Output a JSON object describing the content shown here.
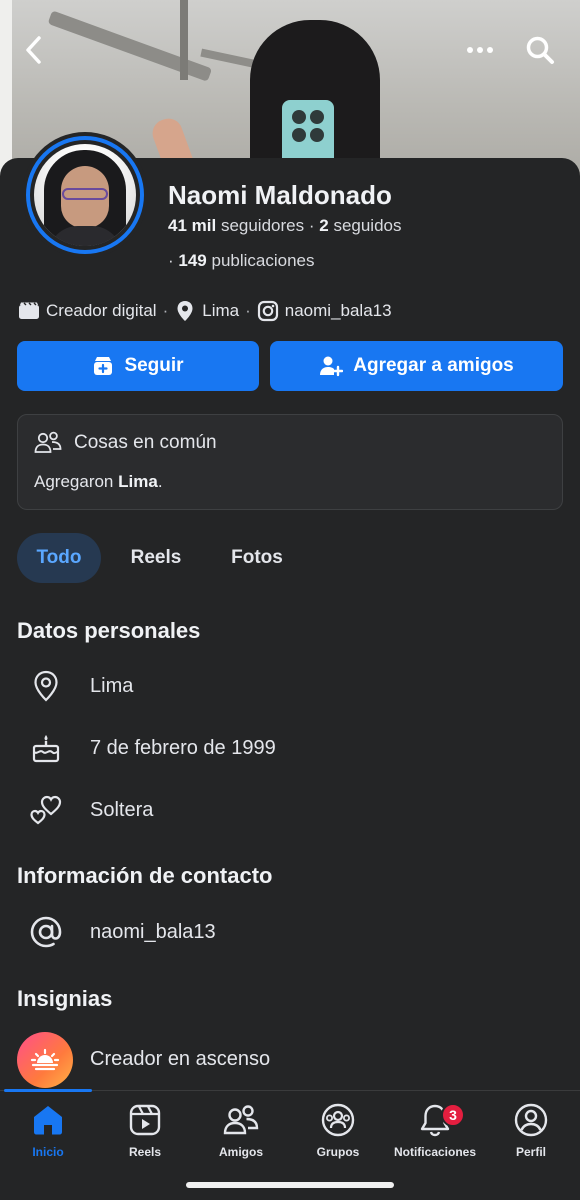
{
  "profile": {
    "name": "Naomi Maldonado",
    "followers_count": "41 mil",
    "followers_label": "seguidores",
    "following_count": "2",
    "following_label": "seguidos",
    "posts_count": "149",
    "posts_label": "publicaciones"
  },
  "meta": {
    "category": "Creador digital",
    "location": "Lima",
    "instagram": "naomi_bala13"
  },
  "actions": {
    "follow_label": "Seguir",
    "add_friend_label": "Agregar a amigos"
  },
  "common": {
    "title": "Cosas en común",
    "text_prefix": "Agregaron",
    "text_bold": "Lima",
    "text_suffix": "."
  },
  "tabs": [
    {
      "label": "Todo",
      "active": true
    },
    {
      "label": "Reels",
      "active": false
    },
    {
      "label": "Fotos",
      "active": false
    }
  ],
  "personal": {
    "title": "Datos personales",
    "items": [
      {
        "icon": "location-icon",
        "label": "Lima"
      },
      {
        "icon": "birthday-cake-icon",
        "label": "7 de febrero de 1999"
      },
      {
        "icon": "hearts-icon",
        "label": "Soltera"
      }
    ]
  },
  "contact": {
    "title": "Información de contacto",
    "items": [
      {
        "icon": "at-icon",
        "label": "naomi_bala13"
      }
    ]
  },
  "badges": {
    "title": "Insignias",
    "items": [
      {
        "icon": "sunrise-icon",
        "label": "Creador en ascenso"
      }
    ]
  },
  "nav": {
    "items": [
      {
        "icon": "home-icon",
        "label": "Inicio",
        "active": true
      },
      {
        "icon": "reels-icon",
        "label": "Reels"
      },
      {
        "icon": "friends-icon",
        "label": "Amigos"
      },
      {
        "icon": "groups-icon",
        "label": "Grupos"
      },
      {
        "icon": "bell-icon",
        "label": "Notificaciones",
        "badge": "3"
      },
      {
        "icon": "profile-icon",
        "label": "Perfil"
      }
    ]
  },
  "colors": {
    "accent": "#1877f2",
    "background": "#242526",
    "badge": "#e41e3f"
  }
}
